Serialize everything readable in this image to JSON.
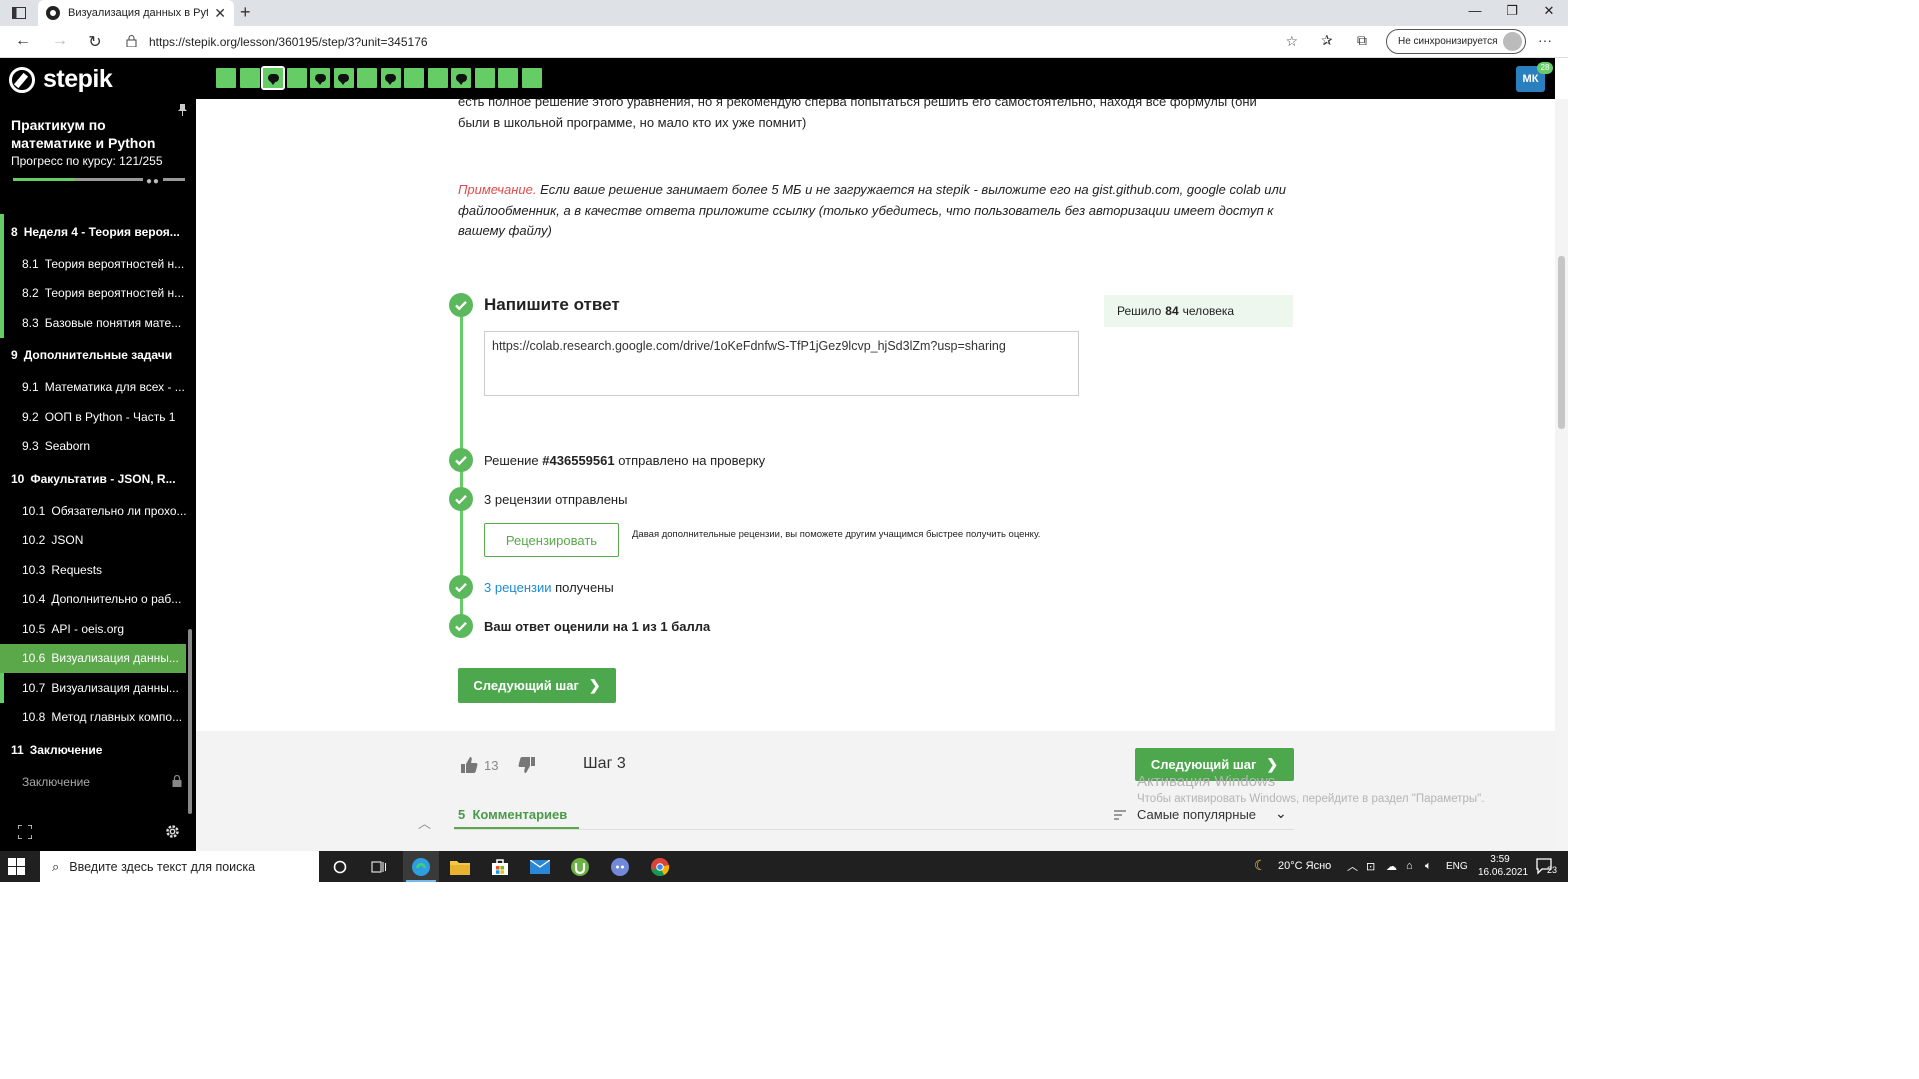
{
  "browser": {
    "tab_title": "Визуализация данных в Python",
    "url": "https://stepik.org/lesson/360195/step/3?unit=345176",
    "sync_label": "Не синхронизируется"
  },
  "header": {
    "logo_text": "stepik",
    "user_initials": "МК",
    "notification_count": "28",
    "steps": [
      {
        "type": "plain"
      },
      {
        "type": "plain"
      },
      {
        "type": "discussion",
        "current": true
      },
      {
        "type": "plain"
      },
      {
        "type": "discussion"
      },
      {
        "type": "discussion"
      },
      {
        "type": "plain"
      },
      {
        "type": "discussion"
      },
      {
        "type": "plain"
      },
      {
        "type": "plain"
      },
      {
        "type": "discussion"
      },
      {
        "type": "plain"
      },
      {
        "type": "plain"
      },
      {
        "type": "plain"
      }
    ]
  },
  "sidebar": {
    "course_title": "Практикум по математике и Python",
    "progress_label": "Прогресс по курсу:  121/255",
    "progress_fraction": 0.4745,
    "items": [
      {
        "kind": "section",
        "num": "8",
        "label": "Неделя 4 - Теория вероя...",
        "done": true
      },
      {
        "kind": "lesson",
        "num": "8.1",
        "label": "Теория вероятностей н...",
        "done": true
      },
      {
        "kind": "lesson",
        "num": "8.2",
        "label": "Теория вероятностей н...",
        "done": true
      },
      {
        "kind": "lesson",
        "num": "8.3",
        "label": "Базовые понятия мате...",
        "done": true
      },
      {
        "kind": "section",
        "num": "9",
        "label": "Дополнительные задачи"
      },
      {
        "kind": "lesson",
        "num": "9.1",
        "label": "Математика для всех - ..."
      },
      {
        "kind": "lesson",
        "num": "9.2",
        "label": "ООП в Python - Часть 1"
      },
      {
        "kind": "lesson",
        "num": "9.3",
        "label": "Seaborn"
      },
      {
        "kind": "section",
        "num": "10",
        "label": "Факультатив - JSON, R..."
      },
      {
        "kind": "lesson",
        "num": "10.1",
        "label": "Обязательно ли прохо..."
      },
      {
        "kind": "lesson",
        "num": "10.2",
        "label": "JSON"
      },
      {
        "kind": "lesson",
        "num": "10.3",
        "label": "Requests"
      },
      {
        "kind": "lesson",
        "num": "10.4",
        "label": "Дополнительно о раб..."
      },
      {
        "kind": "lesson",
        "num": "10.5",
        "label": "API - oeis.org"
      },
      {
        "kind": "lesson",
        "num": "10.6",
        "label": "Визуализация данны...",
        "active": true
      },
      {
        "kind": "lesson",
        "num": "10.7",
        "label": "Визуализация данны...",
        "done": true
      },
      {
        "kind": "lesson",
        "num": "10.8",
        "label": "Метод главных компо..."
      },
      {
        "kind": "section",
        "num": "11",
        "label": "Заключение"
      },
      {
        "kind": "locked",
        "num": "",
        "label": "Заключение"
      }
    ]
  },
  "content": {
    "intro_text": "есть полное решение этого уравнения, но я рекомендую сперва попытаться решить его самостоятельно, находя все формулы (они были в школьной программе, но мало кто их уже помнит)",
    "note_label": "Примечание.",
    "note_text": " Если ваше решение занимает более 5 МБ и не загружается на stepik - выложите его на gist.github.com, google colab или файлообменник, а в качестве ответа приложите ссылку (только убедитесь, что пользователь без авторизации имеет доступ к вашему файлу)",
    "answer_title": "Напишите ответ",
    "answer_value": "https://colab.research.google.com/drive/1oKeFdnfwS-TfP1jGez9lcvp_hjSd3lZm?usp=sharing",
    "solved_prefix": "Решило",
    "solved_count": "84",
    "solved_suffix": "человека",
    "submission_prefix": "Решение",
    "submission_id": "#436559561",
    "submission_suffix": "отправлено на проверку",
    "reviews_sent": "3 рецензии отправлены",
    "review_button": "Рецензировать",
    "review_hint": "Давая дополнительные рецензии, вы поможете другим учащимся быстрее получить оценку.",
    "reviews_received_link": "3 рецензии",
    "reviews_received_suffix": " получены",
    "score_text": "Ваш ответ оценили на 1 из 1 балла",
    "next_step": "Следующий шаг"
  },
  "footer": {
    "likes": "13",
    "step_label": "Шаг 3",
    "next_step": "Следующий шаг",
    "comments_count": "5",
    "comments_label": "Комментариев",
    "sort_label": "Самые популярные",
    "activation_title": "Активация Windows",
    "activation_text": "Чтобы активировать Windows, перейдите в раздел \"Параметры\"."
  },
  "taskbar": {
    "search_placeholder": "Введите здесь текст для поиска",
    "weather": "20°C  Ясно",
    "language": "ENG",
    "time": "3:59",
    "date": "16.06.2021",
    "notifications": "23"
  },
  "colors": {
    "accent_green": "#66cc66",
    "button_green": "#4da84d",
    "link_blue": "#1e8bd3",
    "note_red": "#e04b4b"
  }
}
